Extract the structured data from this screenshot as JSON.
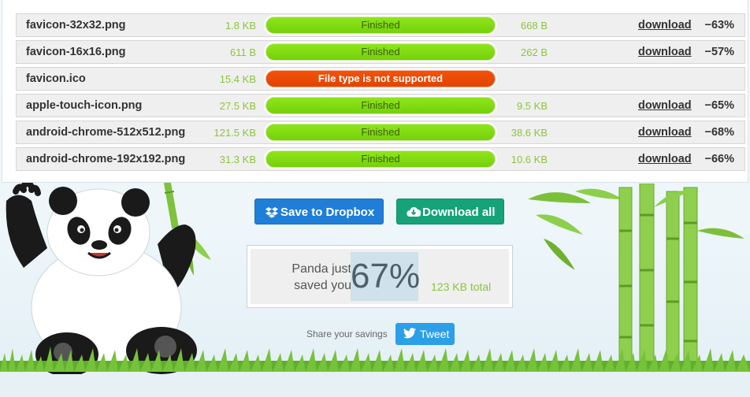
{
  "files": [
    {
      "name": "favicon-32x32.png",
      "original_size": "1.8 KB",
      "status": "Finished",
      "status_type": "ok",
      "new_size": "668 B",
      "action": "download",
      "saving": "−63%"
    },
    {
      "name": "favicon-16x16.png",
      "original_size": "611 B",
      "status": "Finished",
      "status_type": "ok",
      "new_size": "262 B",
      "action": "download",
      "saving": "−57%"
    },
    {
      "name": "favicon.ico",
      "original_size": "15.4 KB",
      "status": "File type is not supported",
      "status_type": "error",
      "new_size": "",
      "action": "",
      "saving": ""
    },
    {
      "name": "apple-touch-icon.png",
      "original_size": "27.5 KB",
      "status": "Finished",
      "status_type": "ok",
      "new_size": "9.5 KB",
      "action": "download",
      "saving": "−65%"
    },
    {
      "name": "android-chrome-512x512.png",
      "original_size": "121.5 KB",
      "status": "Finished",
      "status_type": "ok",
      "new_size": "38.6 KB",
      "action": "download",
      "saving": "−68%"
    },
    {
      "name": "android-chrome-192x192.png",
      "original_size": "31.3 KB",
      "status": "Finished",
      "status_type": "ok",
      "new_size": "10.6 KB",
      "action": "download",
      "saving": "−66%"
    }
  ],
  "actions": {
    "dropbox_label": "Save to Dropbox",
    "dropbox_icon": "dropbox-icon",
    "download_all_label": "Download all",
    "download_all_icon": "cloud-download-icon"
  },
  "savings": {
    "line1": "Panda just",
    "line2": "saved you",
    "percent": "67%",
    "total": "123 KB total"
  },
  "share": {
    "label": "Share your savings",
    "tweet_label": "Tweet",
    "tweet_icon": "twitter-bird-icon"
  },
  "colors": {
    "progress_ok": "#7ed60f",
    "progress_error": "#e84a04",
    "size_text": "#8cc43c",
    "dropbox_button": "#1f7fd8",
    "download_all_button": "#16a37a",
    "tweet_button": "#2b9fe8"
  }
}
